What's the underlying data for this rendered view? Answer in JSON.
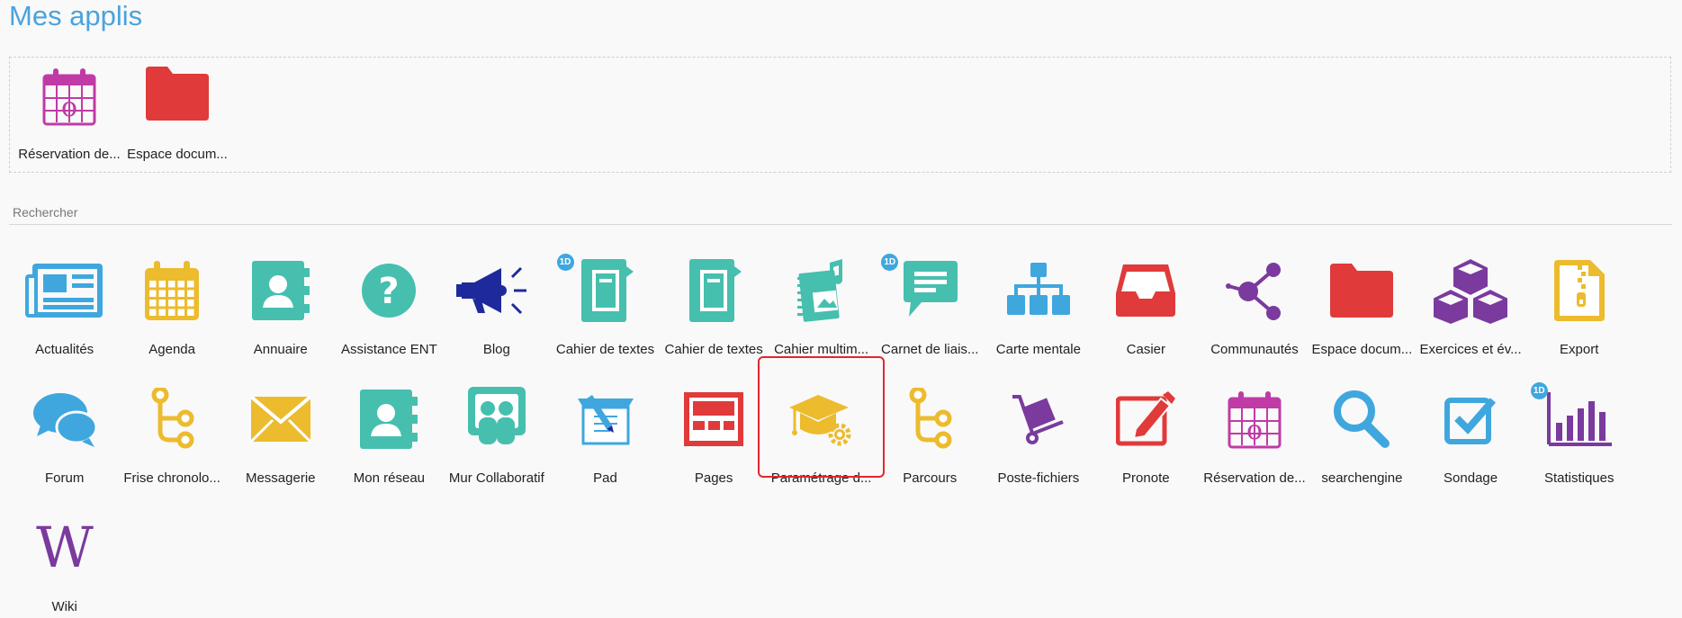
{
  "page": {
    "title": "Mes applis"
  },
  "favorites": [
    {
      "label": "Réservation de...",
      "icon": "calendar-reservation-icon",
      "color": "#c03ba6"
    },
    {
      "label": "Espace docum...",
      "icon": "folder-icon",
      "color": "#e03a3a"
    }
  ],
  "search": {
    "placeholder": "Rechercher",
    "value": ""
  },
  "apps": [
    {
      "label": "Actualités",
      "icon": "newspaper-icon",
      "color": "#3fa7de"
    },
    {
      "label": "Agenda",
      "icon": "calendar-icon",
      "color": "#ecbb2e"
    },
    {
      "label": "Annuaire",
      "icon": "contact-book-icon",
      "color": "#46bfaf"
    },
    {
      "label": "Assistance ENT",
      "icon": "help-icon",
      "color": "#46bfaf"
    },
    {
      "label": "Blog",
      "icon": "megaphone-icon",
      "color": "#1e2a9c"
    },
    {
      "label": "Cahier de textes",
      "icon": "notebook-icon",
      "color": "#46bfaf",
      "badge": "1D"
    },
    {
      "label": "Cahier de textes",
      "icon": "notebook-icon",
      "color": "#46bfaf"
    },
    {
      "label": "Cahier multim...",
      "icon": "multimedia-notebook-icon",
      "color": "#46bfaf"
    },
    {
      "label": "Carnet de liais...",
      "icon": "chat-bubble-icon",
      "color": "#46bfaf",
      "badge": "1D"
    },
    {
      "label": "Carte mentale",
      "icon": "sitemap-icon",
      "color": "#3fa7de"
    },
    {
      "label": "Casier",
      "icon": "inbox-tray-icon",
      "color": "#e03a3a"
    },
    {
      "label": "Communautés",
      "icon": "share-nodes-icon",
      "color": "#7a3a9e"
    },
    {
      "label": "Espace docum...",
      "icon": "folder-icon",
      "color": "#e03a3a"
    },
    {
      "label": "Exercices et év...",
      "icon": "cubes-icon",
      "color": "#7a3a9e"
    },
    {
      "label": "Export",
      "icon": "zip-file-icon",
      "color": "#ecbb2e"
    },
    {
      "label": "Forum",
      "icon": "forum-bubbles-icon",
      "color": "#3fa7de"
    },
    {
      "label": "Frise chronolo...",
      "icon": "timeline-icon",
      "color": "#ecbb2e"
    },
    {
      "label": "Messagerie",
      "icon": "envelope-icon",
      "color": "#ecbb2e"
    },
    {
      "label": "Mon réseau",
      "icon": "contact-book-icon",
      "color": "#46bfaf"
    },
    {
      "label": "Mur Collaboratif",
      "icon": "collaborative-wall-icon",
      "color": "#46bfaf"
    },
    {
      "label": "Pad",
      "icon": "pad-pencil-icon",
      "color": "#3fa7de"
    },
    {
      "label": "Pages",
      "icon": "pages-layout-icon",
      "color": "#e03a3a"
    },
    {
      "label": "Paramétrage d...",
      "icon": "graduation-cap-gear-icon",
      "color": "#ecbb2e",
      "selected": true
    },
    {
      "label": "Parcours",
      "icon": "timeline-icon",
      "color": "#ecbb2e"
    },
    {
      "label": "Poste-fichiers",
      "icon": "hand-truck-icon",
      "color": "#7a3a9e"
    },
    {
      "label": "Pronote",
      "icon": "edit-square-icon",
      "color": "#e03a3a"
    },
    {
      "label": "Réservation de...",
      "icon": "calendar-reservation-icon",
      "color": "#c03ba6"
    },
    {
      "label": "searchengine",
      "icon": "magnifier-icon",
      "color": "#3fa7de"
    },
    {
      "label": "Sondage",
      "icon": "checkbox-icon",
      "color": "#3fa7de"
    },
    {
      "label": "Statistiques",
      "icon": "bar-chart-icon",
      "color": "#7a3a9e",
      "badge": "1D"
    },
    {
      "label": "Wiki",
      "icon": "wiki-w-icon",
      "color": "#7a3a9e"
    }
  ]
}
